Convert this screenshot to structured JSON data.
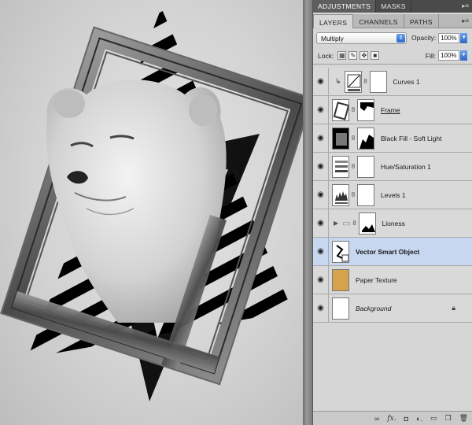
{
  "panel_top": {
    "tabs": [
      {
        "label": "ADJUSTMENTS"
      },
      {
        "label": "MASKS"
      }
    ]
  },
  "panel_layers": {
    "tabs": [
      {
        "label": "LAYERS"
      },
      {
        "label": "CHANNELS"
      },
      {
        "label": "PATHS"
      }
    ],
    "blend_mode": "Multiply",
    "opacity_label": "Opacity:",
    "opacity_value": "100%",
    "lock_label": "Lock:",
    "fill_label": "Fill:",
    "fill_value": "100%",
    "layers": [
      {
        "name": "Curves 1",
        "visible": true,
        "selected": false,
        "style": "normal",
        "thumb_icon": "curves-adjustment-icon"
      },
      {
        "name": "Frame",
        "visible": true,
        "selected": false,
        "style": "underline",
        "thumb_icon": "frame-thumbnail"
      },
      {
        "name": "Black Fill - Soft Light",
        "visible": true,
        "selected": false,
        "style": "normal",
        "thumb_icon": "fill-thumbnail"
      },
      {
        "name": "Hue/Saturation 1",
        "visible": true,
        "selected": false,
        "style": "normal",
        "thumb_icon": "hue-saturation-icon"
      },
      {
        "name": "Levels 1",
        "visible": true,
        "selected": false,
        "style": "normal",
        "thumb_icon": "levels-icon"
      },
      {
        "name": "Lioness",
        "visible": true,
        "selected": false,
        "style": "normal",
        "thumb_icon": "folder-icon"
      },
      {
        "name": "Vector Smart Object",
        "visible": true,
        "selected": true,
        "style": "bold",
        "thumb_icon": "smart-object-icon"
      },
      {
        "name": "Paper Texture",
        "visible": true,
        "selected": false,
        "style": "normal",
        "thumb_icon": "texture-thumbnail"
      },
      {
        "name": "Background",
        "visible": true,
        "selected": false,
        "style": "italic",
        "thumb_icon": "background-thumbnail",
        "locked": true
      }
    ]
  },
  "colors": {
    "selection": "#c6d7ef",
    "accent_blue": "#2e66c8",
    "texture": "#d6a24c"
  },
  "bottom_icons": [
    "link-icon",
    "fx-icon",
    "mask-icon",
    "adjustment-icon",
    "folder-icon",
    "new-layer-icon",
    "trash-icon"
  ]
}
